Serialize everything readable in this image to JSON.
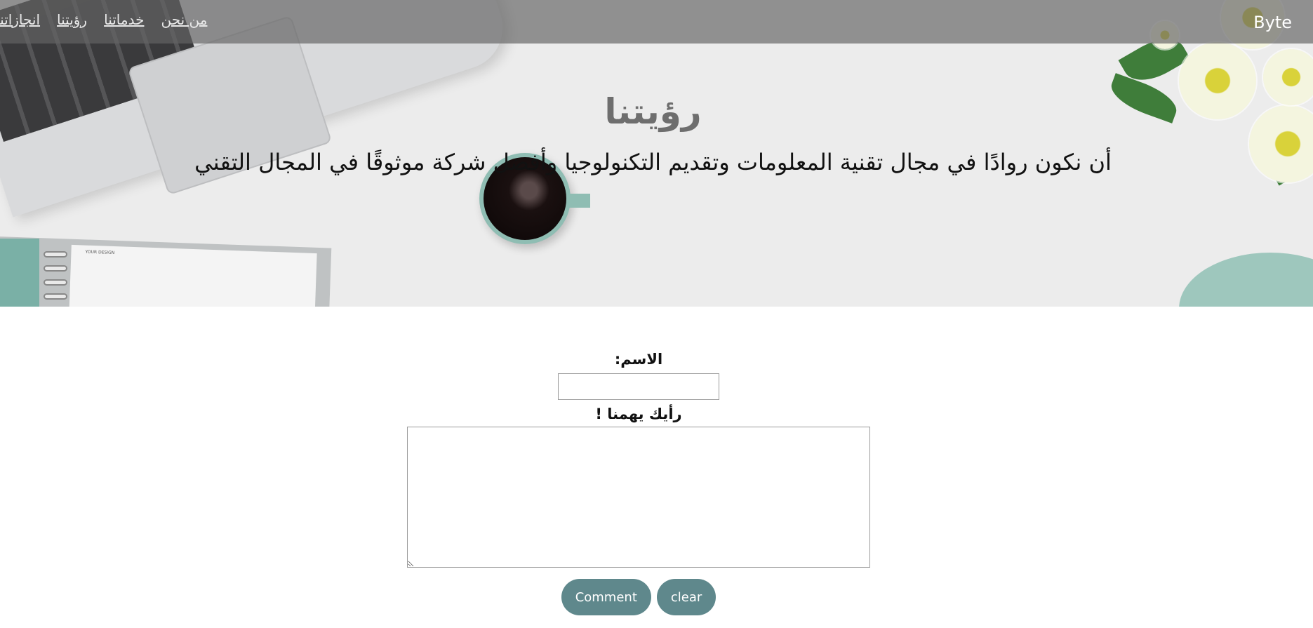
{
  "header": {
    "brand": "Byte",
    "nav": [
      "من نحن",
      "خدماتنا",
      "رؤيتنا",
      "انجازاتنا"
    ]
  },
  "hero": {
    "title": "رؤيتنا",
    "text": "أن نكون روادًا في مجال تقنية المعلومات وتقديم التكنولوجيا وأفضل شركة موثوقًا في المجال التقني",
    "notebook_caption": "YOUR DESIGN"
  },
  "form": {
    "name_label": "الاسم:",
    "name_value": "",
    "opinion_label": "رأيك يهمنا !",
    "opinion_value": "",
    "comment_button": "Comment",
    "clear_button": "clear"
  },
  "colors": {
    "topbar": "#646464",
    "button": "#5f888c",
    "hero_title": "#6e6e6e"
  }
}
